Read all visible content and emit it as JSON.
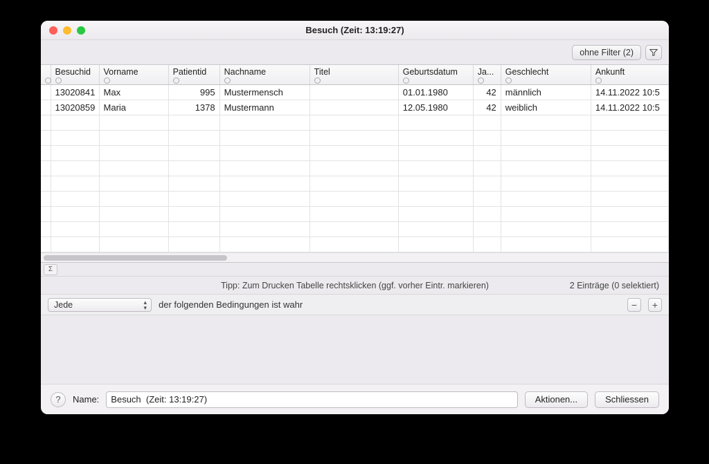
{
  "window": {
    "title": "Besuch  (Zeit: 13:19:27)"
  },
  "filterbar": {
    "filter_button": "ohne Filter (2)"
  },
  "columns": [
    "",
    "Besuchid",
    "Vorname",
    "Patientid",
    "Nachname",
    "Titel",
    "Geburtsdatum",
    "Ja...",
    "Geschlecht",
    "Ankunft"
  ],
  "rows": [
    {
      "besuchid": "13020841",
      "vorname": "Max",
      "patientid": "995",
      "nachname": "Mustermensch",
      "titel": "",
      "geburtsdatum": "01.01.1980",
      "jahre": "42",
      "geschlecht": "männlich",
      "ankunft": "14.11.2022 10:5"
    },
    {
      "besuchid": "13020859",
      "vorname": "Maria",
      "patientid": "1378",
      "nachname": "Mustermann",
      "titel": "",
      "geburtsdatum": "12.05.1980",
      "jahre": "42",
      "geschlecht": "weiblich",
      "ankunft": "14.11.2022 10:5"
    }
  ],
  "tip": "Tipp: Zum Drucken Tabelle rechtsklicken (ggf. vorher Eintr. markieren)",
  "count_text": "2 Einträge (0 selektiert)",
  "condition": {
    "select": "Jede",
    "text": "der folgenden Bedingungen ist wahr"
  },
  "footer": {
    "name_label": "Name:",
    "name_value": "Besuch  (Zeit: 13:19:27)",
    "actions": "Aktionen...",
    "close": "Schliessen"
  },
  "sigma": "Σ"
}
